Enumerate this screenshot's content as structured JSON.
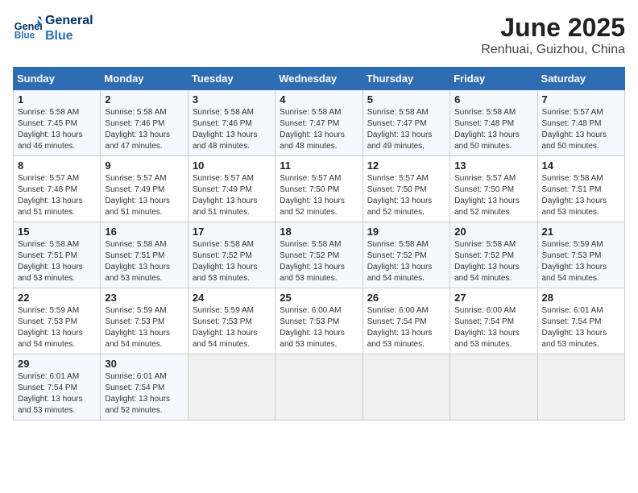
{
  "header": {
    "logo_line1": "General",
    "logo_line2": "Blue",
    "title": "June 2025",
    "subtitle": "Renhuai, Guizhou, China"
  },
  "days_of_week": [
    "Sunday",
    "Monday",
    "Tuesday",
    "Wednesday",
    "Thursday",
    "Friday",
    "Saturday"
  ],
  "weeks": [
    [
      {
        "day": "1",
        "info": "Sunrise: 5:58 AM\nSunset: 7:45 PM\nDaylight: 13 hours\nand 46 minutes."
      },
      {
        "day": "2",
        "info": "Sunrise: 5:58 AM\nSunset: 7:46 PM\nDaylight: 13 hours\nand 47 minutes."
      },
      {
        "day": "3",
        "info": "Sunrise: 5:58 AM\nSunset: 7:46 PM\nDaylight: 13 hours\nand 48 minutes."
      },
      {
        "day": "4",
        "info": "Sunrise: 5:58 AM\nSunset: 7:47 PM\nDaylight: 13 hours\nand 48 minutes."
      },
      {
        "day": "5",
        "info": "Sunrise: 5:58 AM\nSunset: 7:47 PM\nDaylight: 13 hours\nand 49 minutes."
      },
      {
        "day": "6",
        "info": "Sunrise: 5:58 AM\nSunset: 7:48 PM\nDaylight: 13 hours\nand 50 minutes."
      },
      {
        "day": "7",
        "info": "Sunrise: 5:57 AM\nSunset: 7:48 PM\nDaylight: 13 hours\nand 50 minutes."
      }
    ],
    [
      {
        "day": "8",
        "info": "Sunrise: 5:57 AM\nSunset: 7:48 PM\nDaylight: 13 hours\nand 51 minutes."
      },
      {
        "day": "9",
        "info": "Sunrise: 5:57 AM\nSunset: 7:49 PM\nDaylight: 13 hours\nand 51 minutes."
      },
      {
        "day": "10",
        "info": "Sunrise: 5:57 AM\nSunset: 7:49 PM\nDaylight: 13 hours\nand 51 minutes."
      },
      {
        "day": "11",
        "info": "Sunrise: 5:57 AM\nSunset: 7:50 PM\nDaylight: 13 hours\nand 52 minutes."
      },
      {
        "day": "12",
        "info": "Sunrise: 5:57 AM\nSunset: 7:50 PM\nDaylight: 13 hours\nand 52 minutes."
      },
      {
        "day": "13",
        "info": "Sunrise: 5:57 AM\nSunset: 7:50 PM\nDaylight: 13 hours\nand 52 minutes."
      },
      {
        "day": "14",
        "info": "Sunrise: 5:58 AM\nSunset: 7:51 PM\nDaylight: 13 hours\nand 53 minutes."
      }
    ],
    [
      {
        "day": "15",
        "info": "Sunrise: 5:58 AM\nSunset: 7:51 PM\nDaylight: 13 hours\nand 53 minutes."
      },
      {
        "day": "16",
        "info": "Sunrise: 5:58 AM\nSunset: 7:51 PM\nDaylight: 13 hours\nand 53 minutes."
      },
      {
        "day": "17",
        "info": "Sunrise: 5:58 AM\nSunset: 7:52 PM\nDaylight: 13 hours\nand 53 minutes."
      },
      {
        "day": "18",
        "info": "Sunrise: 5:58 AM\nSunset: 7:52 PM\nDaylight: 13 hours\nand 53 minutes."
      },
      {
        "day": "19",
        "info": "Sunrise: 5:58 AM\nSunset: 7:52 PM\nDaylight: 13 hours\nand 54 minutes."
      },
      {
        "day": "20",
        "info": "Sunrise: 5:58 AM\nSunset: 7:52 PM\nDaylight: 13 hours\nand 54 minutes."
      },
      {
        "day": "21",
        "info": "Sunrise: 5:59 AM\nSunset: 7:53 PM\nDaylight: 13 hours\nand 54 minutes."
      }
    ],
    [
      {
        "day": "22",
        "info": "Sunrise: 5:59 AM\nSunset: 7:53 PM\nDaylight: 13 hours\nand 54 minutes."
      },
      {
        "day": "23",
        "info": "Sunrise: 5:59 AM\nSunset: 7:53 PM\nDaylight: 13 hours\nand 54 minutes."
      },
      {
        "day": "24",
        "info": "Sunrise: 5:59 AM\nSunset: 7:53 PM\nDaylight: 13 hours\nand 54 minutes."
      },
      {
        "day": "25",
        "info": "Sunrise: 6:00 AM\nSunset: 7:53 PM\nDaylight: 13 hours\nand 53 minutes."
      },
      {
        "day": "26",
        "info": "Sunrise: 6:00 AM\nSunset: 7:54 PM\nDaylight: 13 hours\nand 53 minutes."
      },
      {
        "day": "27",
        "info": "Sunrise: 6:00 AM\nSunset: 7:54 PM\nDaylight: 13 hours\nand 53 minutes."
      },
      {
        "day": "28",
        "info": "Sunrise: 6:01 AM\nSunset: 7:54 PM\nDaylight: 13 hours\nand 53 minutes."
      }
    ],
    [
      {
        "day": "29",
        "info": "Sunrise: 6:01 AM\nSunset: 7:54 PM\nDaylight: 13 hours\nand 53 minutes."
      },
      {
        "day": "30",
        "info": "Sunrise: 6:01 AM\nSunset: 7:54 PM\nDaylight: 13 hours\nand 52 minutes."
      },
      {
        "day": "",
        "info": ""
      },
      {
        "day": "",
        "info": ""
      },
      {
        "day": "",
        "info": ""
      },
      {
        "day": "",
        "info": ""
      },
      {
        "day": "",
        "info": ""
      }
    ]
  ]
}
